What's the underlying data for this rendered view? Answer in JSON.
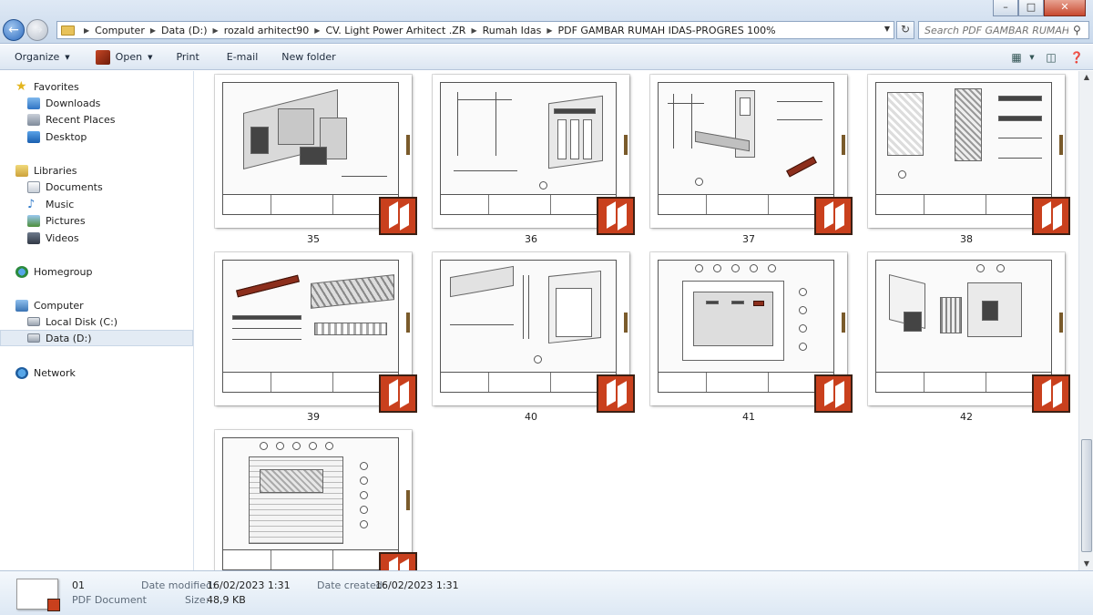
{
  "window": {
    "controls": {
      "minimize": "–",
      "maximize": "□",
      "close": "✕"
    }
  },
  "address": {
    "crumbs": [
      "Computer",
      "Data (D:)",
      "rozald arhitect90",
      "CV. Light Power Arhitect .ZR",
      "Rumah Idas",
      "PDF GAMBAR RUMAH IDAS-PROGRES 100%"
    ],
    "search_placeholder": "Search PDF GAMBAR RUMAH ID..."
  },
  "toolbar": {
    "organize": "Organize",
    "open": "Open",
    "print": "Print",
    "email": "E-mail",
    "new_folder": "New folder"
  },
  "nav": {
    "favorites": "Favorites",
    "downloads": "Downloads",
    "recent_places": "Recent Places",
    "desktop": "Desktop",
    "libraries": "Libraries",
    "documents": "Documents",
    "music": "Music",
    "pictures": "Pictures",
    "videos": "Videos",
    "homegroup": "Homegroup",
    "computer": "Computer",
    "local_disk": "Local Disk (C:)",
    "data_disk": "Data (D:)",
    "network": "Network"
  },
  "files": [
    {
      "name": "35",
      "icon": "pdf-file-icon"
    },
    {
      "name": "36",
      "icon": "pdf-file-icon"
    },
    {
      "name": "37",
      "icon": "pdf-file-icon"
    },
    {
      "name": "38",
      "icon": "pdf-file-icon"
    },
    {
      "name": "39",
      "icon": "pdf-file-icon"
    },
    {
      "name": "40",
      "icon": "pdf-file-icon"
    },
    {
      "name": "41",
      "icon": "pdf-file-icon"
    },
    {
      "name": "42",
      "icon": "pdf-file-icon"
    },
    {
      "name": "",
      "icon": "pdf-file-icon"
    }
  ],
  "details": {
    "file_name": "01",
    "file_type": "PDF Document",
    "date_modified_label": "Date modified:",
    "date_modified": "16/02/2023 1:31",
    "date_created_label": "Date created:",
    "date_created": "16/02/2023 1:31",
    "size_label": "Size:",
    "size": "48,9 KB"
  },
  "colors": {
    "accent": "#2d6bbf",
    "pdf_brand": "#c9401d",
    "selection": "#e3ebf4"
  }
}
